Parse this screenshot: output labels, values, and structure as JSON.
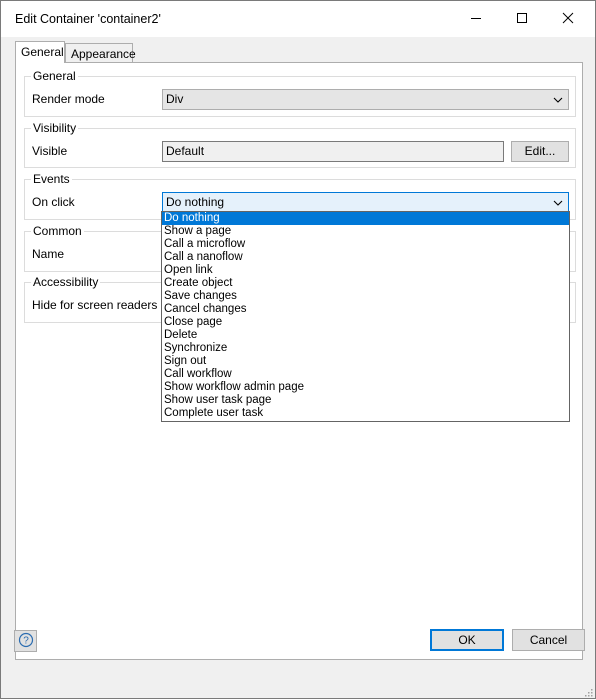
{
  "window": {
    "title": "Edit Container 'container2'",
    "controls": [
      "minimize-icon",
      "maximize-icon",
      "close-icon"
    ]
  },
  "tabs": [
    {
      "label": "General",
      "active": true
    },
    {
      "label": "Appearance",
      "active": false
    }
  ],
  "groups": {
    "general": {
      "title": "General",
      "render_mode_label": "Render mode",
      "render_mode_value": "Div"
    },
    "visibility": {
      "title": "Visibility",
      "visible_label": "Visible",
      "visible_value": "Default",
      "edit_button": "Edit..."
    },
    "events": {
      "title": "Events",
      "on_click_label": "On click",
      "on_click_value": "Do nothing"
    },
    "common": {
      "title": "Common",
      "name_label": "Name"
    },
    "accessibility": {
      "title": "Accessibility",
      "hide_label": "Hide for screen readers"
    }
  },
  "dropdown": {
    "selected_index": 0,
    "options": [
      "Do nothing",
      "Show a page",
      "Call a microflow",
      "Call a nanoflow",
      "Open link",
      "Create object",
      "Save changes",
      "Cancel changes",
      "Close page",
      "Delete",
      "Synchronize",
      "Sign out",
      "Call workflow",
      "Show workflow admin page",
      "Show user task page",
      "Complete user task"
    ]
  },
  "footer": {
    "help_icon": "help-icon",
    "ok_label": "OK",
    "cancel_label": "Cancel"
  },
  "colors": {
    "accent": "#0078d7",
    "window_bg": "#f0f0f0",
    "panel_bg": "#ffffff"
  }
}
